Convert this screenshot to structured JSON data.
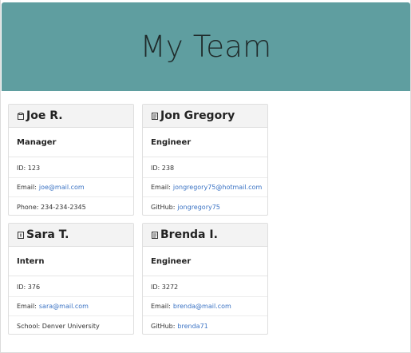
{
  "header": {
    "title": "My Team"
  },
  "colors": {
    "hero_bg": "#5f9ea0",
    "link": "#3b73c4"
  },
  "cards": [
    {
      "icon": "clipboard-icon",
      "name": "Joe R.",
      "role": "Manager",
      "rows": [
        {
          "label": "ID: 123",
          "value": ""
        },
        {
          "label": "Email:",
          "value": "joe@mail.com",
          "link": true
        },
        {
          "label": "Phone: 234-234-2345",
          "value": ""
        }
      ]
    },
    {
      "icon": "document-icon",
      "name": "Jon Gregory",
      "role": "Engineer",
      "rows": [
        {
          "label": "ID: 238",
          "value": ""
        },
        {
          "label": "Email:",
          "value": "jongregory75@hotmail.com",
          "link": true
        },
        {
          "label": "GitHub:",
          "value": "jongregory75",
          "link": true
        }
      ]
    },
    {
      "icon": "student-badge-icon",
      "name": "Sara T.",
      "role": "Intern",
      "rows": [
        {
          "label": "ID: 376",
          "value": ""
        },
        {
          "label": "Email:",
          "value": "sara@mail.com",
          "link": true
        },
        {
          "label": "School: Denver University",
          "value": ""
        }
      ]
    },
    {
      "icon": "document-icon",
      "name": "Brenda I.",
      "role": "Engineer",
      "rows": [
        {
          "label": "ID: 3272",
          "value": ""
        },
        {
          "label": "Email:",
          "value": "brenda@mail.com",
          "link": true
        },
        {
          "label": "GitHub:",
          "value": "brenda71",
          "link": true
        }
      ]
    }
  ]
}
